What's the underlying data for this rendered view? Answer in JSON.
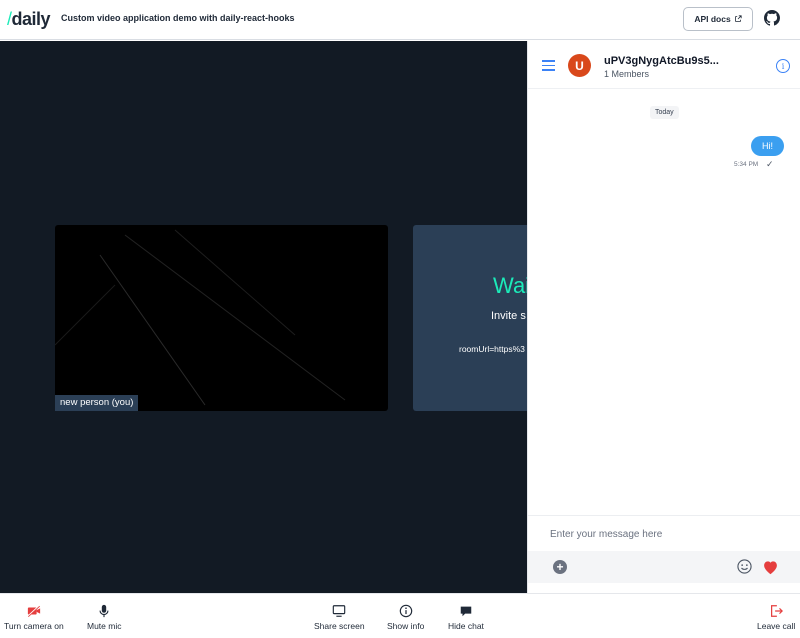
{
  "header": {
    "logo_slash": "/",
    "logo_text": "daily",
    "title": "Custom video application demo with daily-react-hooks",
    "api_docs_label": "API docs",
    "github_icon": "github-icon"
  },
  "stage": {
    "self_name": "new person (you)",
    "waiting_title": "Wai",
    "waiting_sub": "Invite s",
    "room_url_text": "roomUrl=https%3"
  },
  "chat": {
    "avatar_letter": "U",
    "room_name": "uPV3gNygAtcBu9s5...",
    "members": "1 Members",
    "date_label": "Today",
    "messages": [
      {
        "text": "Hi!",
        "time": "5:34 PM",
        "status": "✓"
      }
    ],
    "input_placeholder": "Enter your message here",
    "accent": "#3b9ff0",
    "heart_color": "#e53e3e"
  },
  "tray": {
    "camera_label": "Turn camera on",
    "mic_label": "Mute mic",
    "share_label": "Share screen",
    "info_label": "Show info",
    "chat_label": "Hide chat",
    "leave_label": "Leave call"
  },
  "colors": {
    "stage_bg": "#121a24",
    "brand_green": "#1bebb9",
    "danger": "#e53e3e",
    "tile_bg": "#2b3f56"
  }
}
